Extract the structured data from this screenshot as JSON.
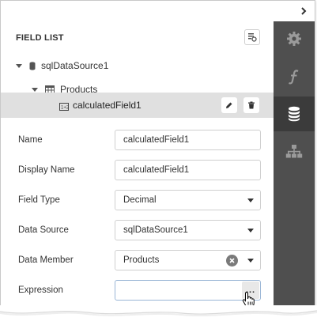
{
  "panel": {
    "title": "FIELD LIST",
    "tree": {
      "datasource": "sqlDataSource1",
      "table": "Products",
      "selected_field": "calculatedField1"
    }
  },
  "properties": [
    {
      "label": "Name",
      "value": "calculatedField1",
      "type": "text"
    },
    {
      "label": "Display Name",
      "value": "calculatedField1",
      "type": "text"
    },
    {
      "label": "Field Type",
      "value": "Decimal",
      "type": "select"
    },
    {
      "label": "Data Source",
      "value": "sqlDataSource1",
      "type": "select"
    },
    {
      "label": "Data Member",
      "value": "Products",
      "type": "select-clear"
    },
    {
      "label": "Expression",
      "value": "",
      "type": "expression"
    }
  ],
  "expression_button_label": "...",
  "sidebar": {
    "items": [
      {
        "icon": "gear-icon",
        "active": false
      },
      {
        "icon": "function-icon",
        "active": false
      },
      {
        "icon": "database-icon",
        "active": true
      },
      {
        "icon": "hierarchy-icon",
        "active": false
      }
    ]
  },
  "colors": {
    "sidebar_bg": "#4f4f4f",
    "sidebar_active": "#3b3b3b",
    "selected_row": "#e0e0e0"
  }
}
